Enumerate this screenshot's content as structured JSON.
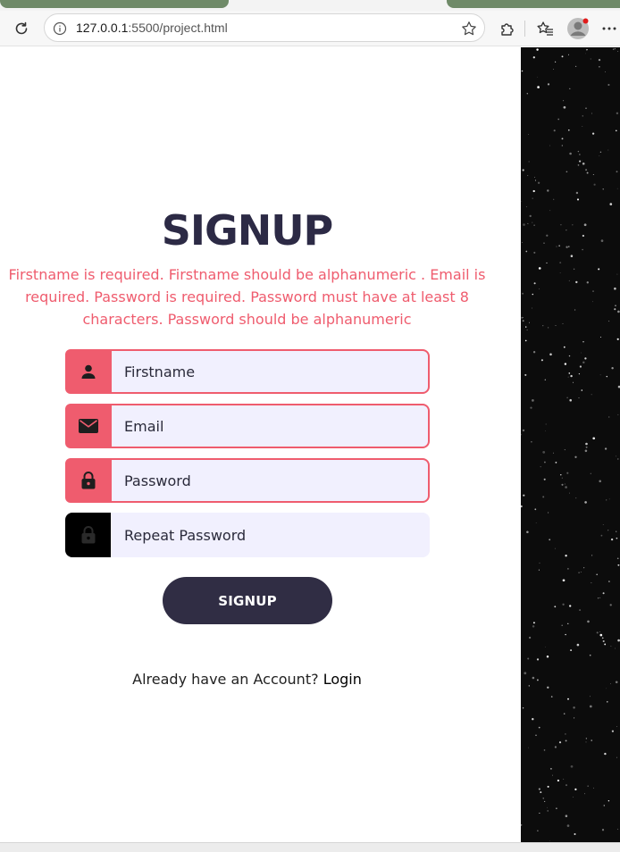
{
  "browser": {
    "url_host": "127.0.0.1",
    "url_rest": ":5500/project.html",
    "icons": {
      "refresh": "refresh-icon",
      "info": "info-icon",
      "favorite": "star-icon",
      "extensions": "puzzle-icon",
      "favorites_bar": "favorites-icon",
      "profile": "avatar-icon",
      "menu": "more-icon"
    }
  },
  "form": {
    "title": "SIGNUP",
    "errors": "Firstname is required. Firstname should be alphanumeric . Email is required. Password is required. Password must have at least 8 characters. Password should be alphanumeric",
    "fields": [
      {
        "placeholder": "Firstname",
        "icon": "user-icon",
        "state": "invalid"
      },
      {
        "placeholder": "Email",
        "icon": "envelope-icon",
        "state": "invalid"
      },
      {
        "placeholder": "Password",
        "icon": "lock-icon",
        "state": "invalid"
      },
      {
        "placeholder": "Repeat Password",
        "icon": "lock-icon",
        "state": "default"
      }
    ],
    "submit_label": "SIGNUP",
    "login_prompt": "Already have an Account?",
    "login_link": "Login"
  },
  "colors": {
    "accent_error": "#ef5c6e",
    "title": "#2c2a45",
    "button": "#302d44",
    "input_bg": "#f1f0fe",
    "side_panel": "#0c0c0c"
  }
}
